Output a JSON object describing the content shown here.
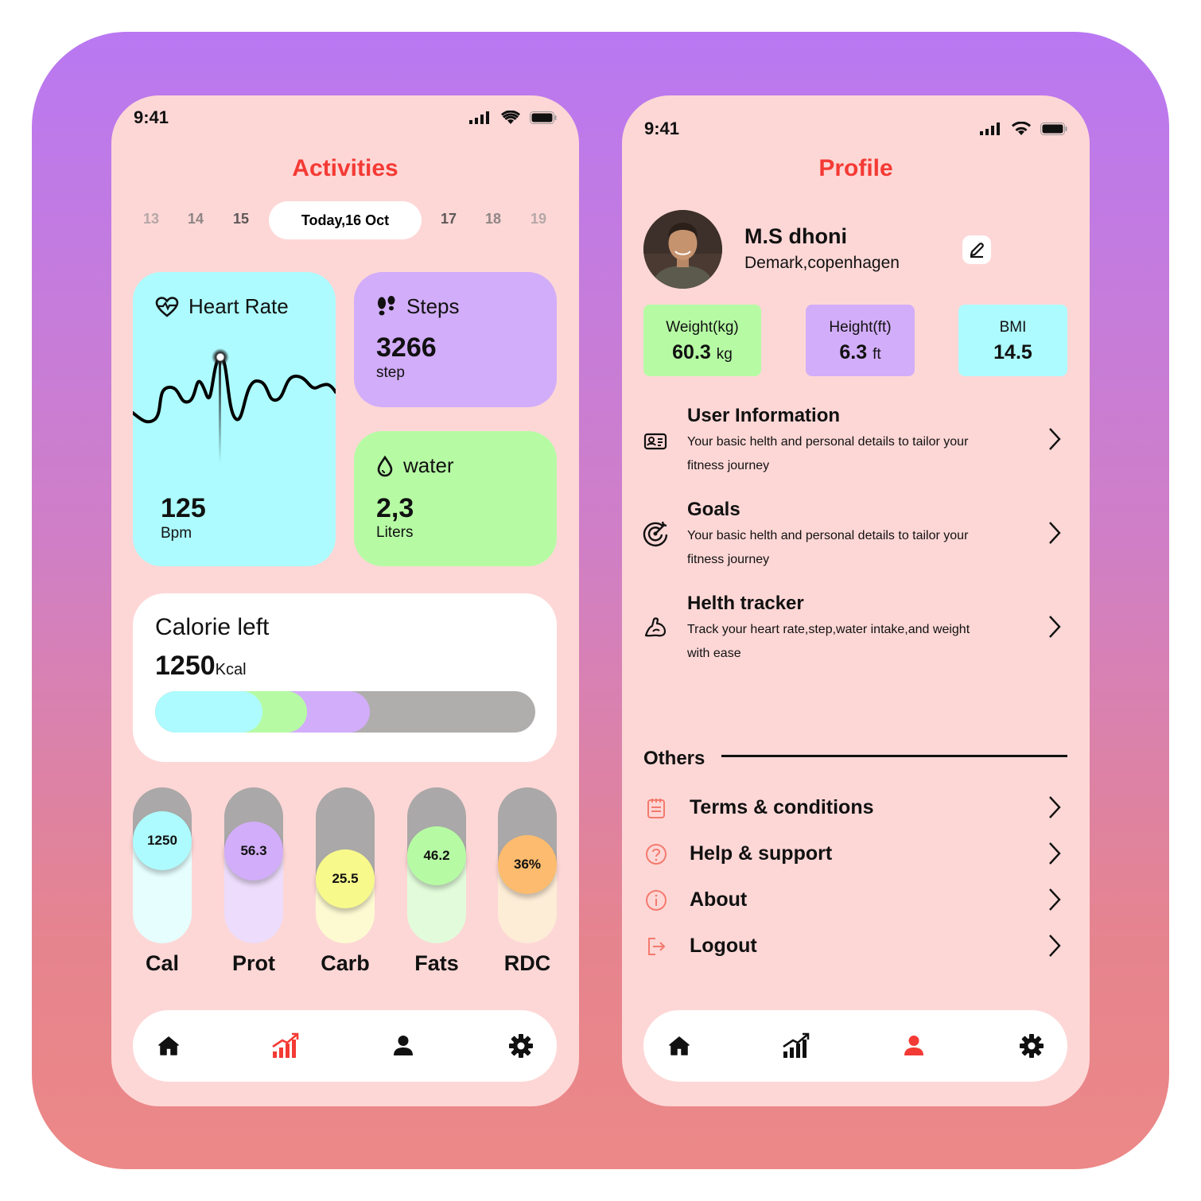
{
  "activities": {
    "status_time": "9:41",
    "title": "Activities",
    "dates": [
      "13",
      "14",
      "15",
      "17",
      "18",
      "19"
    ],
    "today_label": "Today,16 Oct",
    "heart": {
      "label": "Heart Rate",
      "value": "125",
      "unit": "Bpm"
    },
    "steps": {
      "label": "Steps",
      "value": "3266",
      "unit": "step"
    },
    "water": {
      "label": "water",
      "value": "2,3",
      "unit": "Liters"
    },
    "calorie": {
      "label": "Calorie left",
      "value": "1250",
      "unit": "Kcal"
    },
    "nutrients": [
      {
        "label": "Cal",
        "value": "1250"
      },
      {
        "label": "Prot",
        "value": "56.3"
      },
      {
        "label": "Carb",
        "value": "25.5"
      },
      {
        "label": "Fats",
        "value": "46.2"
      },
      {
        "label": "RDC",
        "value": "36%"
      }
    ]
  },
  "profile": {
    "status_time": "9:41",
    "title": "Profile",
    "name": "M.S dhoni",
    "location": "Demark,copenhagen",
    "stats": {
      "weight_label": "Weight(kg)",
      "weight_value": "60.3",
      "weight_unit": "kg",
      "height_label": "Height(ft)",
      "height_value": "6.3",
      "height_unit": "ft",
      "bmi_label": "BMI",
      "bmi_value": "14.5"
    },
    "menu": [
      {
        "title": "User Information",
        "desc": "Your basic helth and personal details to tailor your fitness journey"
      },
      {
        "title": "Goals",
        "desc": "Your basic helth and personal details to tailor your fitness journey"
      },
      {
        "title": "Helth tracker",
        "desc": "Track your heart rate,step,water intake,and  weight with ease"
      }
    ],
    "others_label": "Others",
    "others": [
      {
        "label": "Terms & conditions"
      },
      {
        "label": "Help & support"
      },
      {
        "label": "About"
      },
      {
        "label": "Logout"
      }
    ]
  },
  "colors": {
    "accent": "#f43a34",
    "heart_card": "#adfbfe",
    "steps_card": "#d2adf9",
    "water_card": "#b6fba4"
  }
}
